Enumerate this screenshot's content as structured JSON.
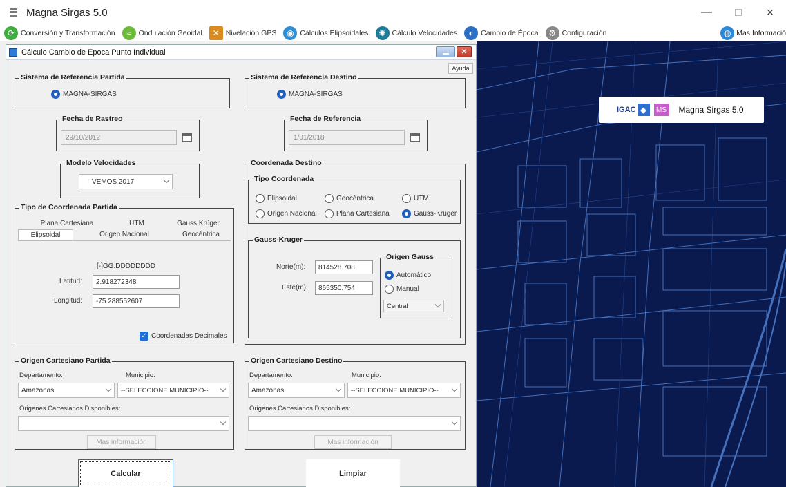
{
  "window": {
    "title": "Magna Sirgas 5.0",
    "minimize": "—",
    "close": "×"
  },
  "menu": [
    {
      "label": "Conversión y Transformación",
      "icon": "conversion-icon",
      "color": "#3fae3f"
    },
    {
      "label": "Ondulación Geoidal",
      "icon": "geoid-icon",
      "color": "#6dbb3a"
    },
    {
      "label": "Nivelación GPS",
      "icon": "gps-level-icon",
      "color": "#d98b1f"
    },
    {
      "label": "Cálculos Elipsoidales",
      "icon": "ellipsoid-icon",
      "color": "#2f8fd6"
    },
    {
      "label": "Cálculo Velocidades",
      "icon": "velocity-icon",
      "color": "#1c7c9a"
    },
    {
      "label": "Cambio de Época",
      "icon": "epoch-icon",
      "color": "#2c6fc5"
    },
    {
      "label": "Configuración",
      "icon": "gear-icon",
      "color": "#888888"
    }
  ],
  "menu_right": {
    "label": "Mas Informació",
    "icon": "globe-icon"
  },
  "banner": {
    "igac": "IGAC",
    "ms": "MS",
    "title": "Magna Sirgas 5.0"
  },
  "dialog": {
    "title": "Cálculo Cambio de Época Punto Individual",
    "help": "Ayuda",
    "ref_partida": {
      "legend": "Sistema de Referencia Partida",
      "option": "MAGNA-SIRGAS"
    },
    "ref_destino": {
      "legend": "Sistema de Referencia Destino",
      "option": "MAGNA-SIRGAS"
    },
    "fecha_rastreo": {
      "legend": "Fecha de Rastreo",
      "value": "29/10/2012"
    },
    "fecha_referencia": {
      "legend": "Fecha de Referencia",
      "value": "1/01/2018"
    },
    "modelo": {
      "legend": "Modelo Velocidades",
      "value": "VEMOS 2017"
    },
    "tipo_partida": {
      "legend": "Tipo de Coordenada Partida",
      "tabs_row1": [
        "Plana Cartesiana",
        "UTM",
        "Gauss Krüger"
      ],
      "tabs_row2": [
        "Elipsoidal",
        "Origen Nacional",
        "Geocéntrica"
      ],
      "format": "[-]GG.DDDDDDDD",
      "lat_label": "Latitud:",
      "lat_value": "2.918272348",
      "lon_label": "Longitud:",
      "lon_value": "-75.288552607",
      "decimal_check": "Coordenadas Decimales"
    },
    "coord_destino": {
      "legend": "Coordenada Destino",
      "tipo_legend": "Tipo Coordenada",
      "options": [
        "Elipsoidal",
        "Geocéntrica",
        "UTM",
        "Origen Nacional",
        "Plana Cartesiana",
        "Gauss-Krüger"
      ],
      "selected": "Gauss-Krüger",
      "gk_legend": "Gauss-Kruger",
      "norte_label": "Norte(m):",
      "norte_value": "814528.708",
      "este_label": "Este(m):",
      "este_value": "865350.754",
      "origen_legend": "Origen Gauss",
      "auto": "Automático",
      "manual": "Manual",
      "origen_value": "Central"
    },
    "cart_partida": {
      "legend": "Origen Cartesiano Partida",
      "dep_label": "Departamento:",
      "mun_label": "Municipio:",
      "dep_value": "Amazonas",
      "mun_value": "--SELECCIONE MUNICIPIO--",
      "disp_label": "Origenes Cartesianos Disponibles:",
      "more": "Mas información"
    },
    "cart_destino": {
      "legend": "Origen Cartesiano Destino",
      "dep_label": "Departamento:",
      "mun_label": "Municipio:",
      "dep_value": "Amazonas",
      "mun_value": "--SELECCIONE MUNICIPIO--",
      "disp_label": "Origenes Cartesianos Disponibles:",
      "more": "Mas información"
    },
    "calcular": "Calcular",
    "limpiar": "Limpiar"
  }
}
